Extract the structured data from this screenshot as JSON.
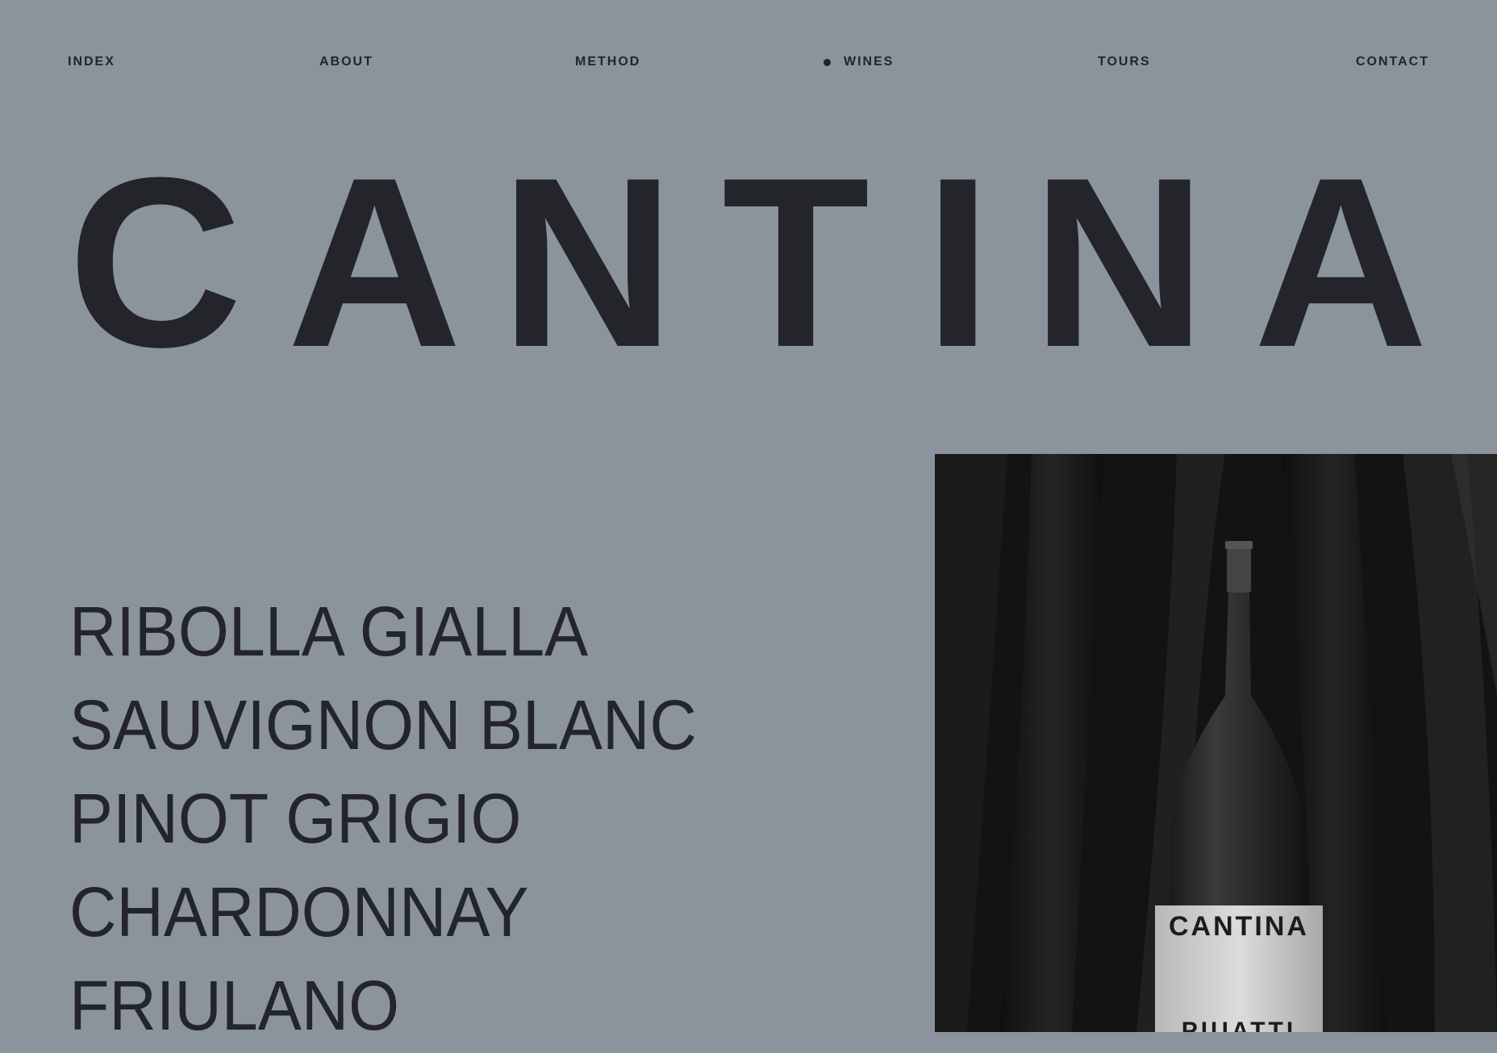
{
  "nav": {
    "items": [
      {
        "label": "INDEX",
        "active": false
      },
      {
        "label": "ABOUT",
        "active": false
      },
      {
        "label": "METHOD",
        "active": false
      },
      {
        "label": "WINES",
        "active": true
      },
      {
        "label": "TOURS",
        "active": false
      },
      {
        "label": "CONTACT",
        "active": false
      }
    ]
  },
  "brand": {
    "letters": [
      "C",
      "A",
      "N",
      "T",
      "I",
      "N",
      "A"
    ]
  },
  "wines": [
    "RIBOLLA GIALLA",
    "SAUVIGNON BLANC",
    "PINOT GRIGIO",
    "CHARDONNAY",
    "FRIULANO"
  ],
  "photo": {
    "label_brand": "CANTINA",
    "label_sub": "PIUATTI"
  },
  "colors": {
    "background": "#8b949c",
    "text": "#23252b",
    "photo_bg": "#121212"
  }
}
